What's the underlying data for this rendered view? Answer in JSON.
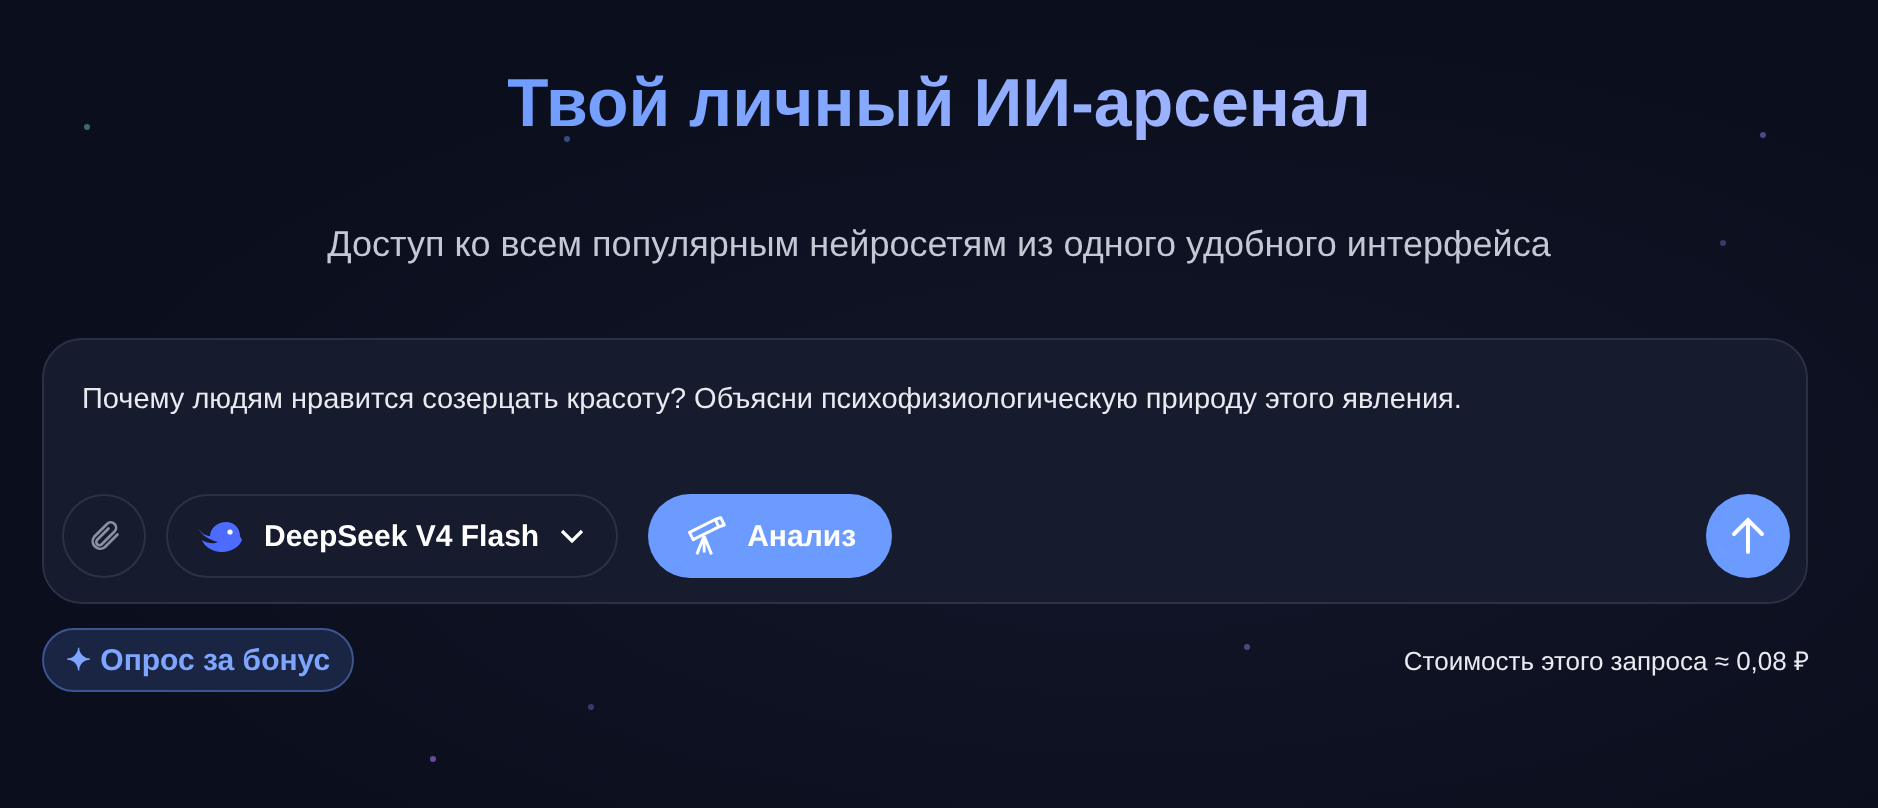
{
  "hero": {
    "title": "Твой личный ИИ-арсенал",
    "subtitle": "Доступ ко всем популярным нейросетям из одного удобного интерфейса"
  },
  "composer": {
    "prompt": "Почему людям нравится созерцать красоту? Объясни психофизиологическую природу этого явления.",
    "model": "DeepSeek V4 Flash",
    "mode": {
      "label": "Анализ",
      "on": true
    }
  },
  "footer": {
    "bonus": "✦ Опрос за бонус",
    "cost": "Стоимость этого запроса ≈ 0,08 ₽"
  }
}
